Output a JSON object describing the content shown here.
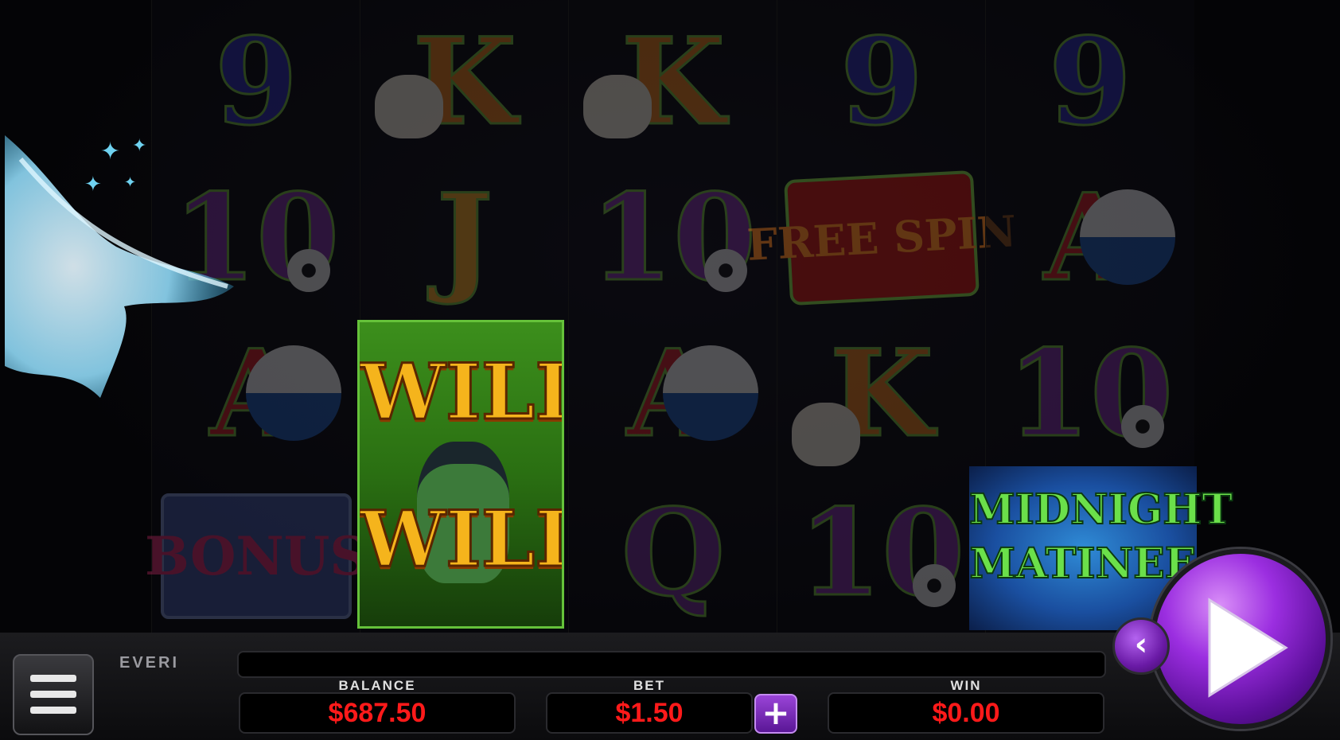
{
  "brand": "EVERI",
  "reels": [
    {
      "symbols": [
        "9",
        "10",
        "A",
        "BONUS"
      ]
    },
    {
      "symbols": [
        "K",
        "J",
        "WILD",
        "WILD"
      ]
    },
    {
      "symbols": [
        "K",
        "10",
        "A",
        "Q"
      ]
    },
    {
      "symbols": [
        "9",
        "FREE SPIN",
        "K",
        "10"
      ]
    },
    {
      "symbols": [
        "9",
        "A",
        "10",
        "MIDNIGHT MATINEE"
      ]
    }
  ],
  "wild": {
    "line1": "WILD",
    "line2": "WILD"
  },
  "free_spin": {
    "line1": "FREE",
    "line2": "SPIN"
  },
  "bonus_label": "BONUS",
  "logo": {
    "line1": "MIDNIGHT",
    "line2": "MATINEE"
  },
  "meters": {
    "balance_label": "BALANCE",
    "balance_value": "$687.50",
    "bet_label": "BET",
    "bet_value": "$1.50",
    "win_label": "WIN",
    "win_value": "$0.00"
  },
  "buttons": {
    "plus": "+",
    "back": "‹",
    "spin": "play-icon",
    "menu": "hamburger-icon"
  },
  "colors": {
    "meter_value": "#ff1a1a",
    "spin_button": "#9b2ee0",
    "wild_gold": "#f5b41c"
  }
}
